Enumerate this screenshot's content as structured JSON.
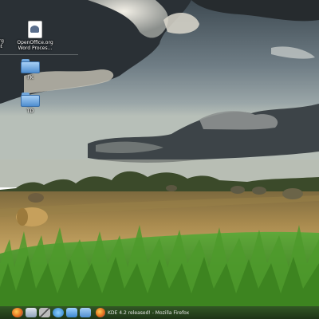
{
  "desktop": {
    "items": [
      {
        "label_line1": "org",
        "label_line2": "et"
      },
      {
        "label_line1": "OpenOffice.org",
        "label_line2": "Word Proces..."
      },
      {
        "label_line1": "FK"
      },
      {
        "label_line1": "TD"
      }
    ]
  },
  "taskbar": {
    "launchers": [
      "firefox-icon",
      "system-settings-icon",
      "tools-icon",
      "network-icon",
      "desktop-icon",
      "folder-icon"
    ],
    "window_title": "KDE 4.2 released! - Mozilla Firefox",
    "accent": "#f08a24"
  }
}
